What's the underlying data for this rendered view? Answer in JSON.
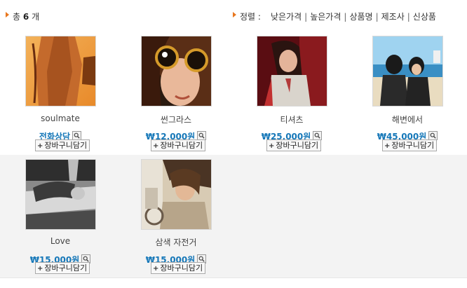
{
  "header": {
    "total_prefix": "총",
    "total_count": "6",
    "total_suffix": "개",
    "sort_label": "정렬 :",
    "sort_options": [
      "낮은가격",
      "높은가격",
      "상품명",
      "제조사",
      "신상품"
    ]
  },
  "colors": {
    "accent_arrow": "#e8771e",
    "price": "#1577b8",
    "row_alt_background": "#f3f3f3"
  },
  "products": [
    {
      "name": "soulmate",
      "price": "전화상담",
      "cart_label": "장바구니담기",
      "icon": "zoom-icon"
    },
    {
      "name": "썬그라스",
      "price": "₩12,000원",
      "cart_label": "장바구니담기",
      "icon": "zoom-icon"
    },
    {
      "name": "티셔츠",
      "price": "₩25,000원",
      "cart_label": "장바구니담기",
      "icon": "zoom-icon"
    },
    {
      "name": "해변에서",
      "price": "₩45,000원",
      "cart_label": "장바구니담기",
      "icon": "zoom-icon"
    },
    {
      "name": "Love",
      "price": "₩15,000원",
      "cart_label": "장바구니담기",
      "icon": "zoom-icon"
    },
    {
      "name": "삼색 자전거",
      "price": "₩15,000원",
      "cart_label": "장바구니담기",
      "icon": "zoom-icon"
    }
  ]
}
